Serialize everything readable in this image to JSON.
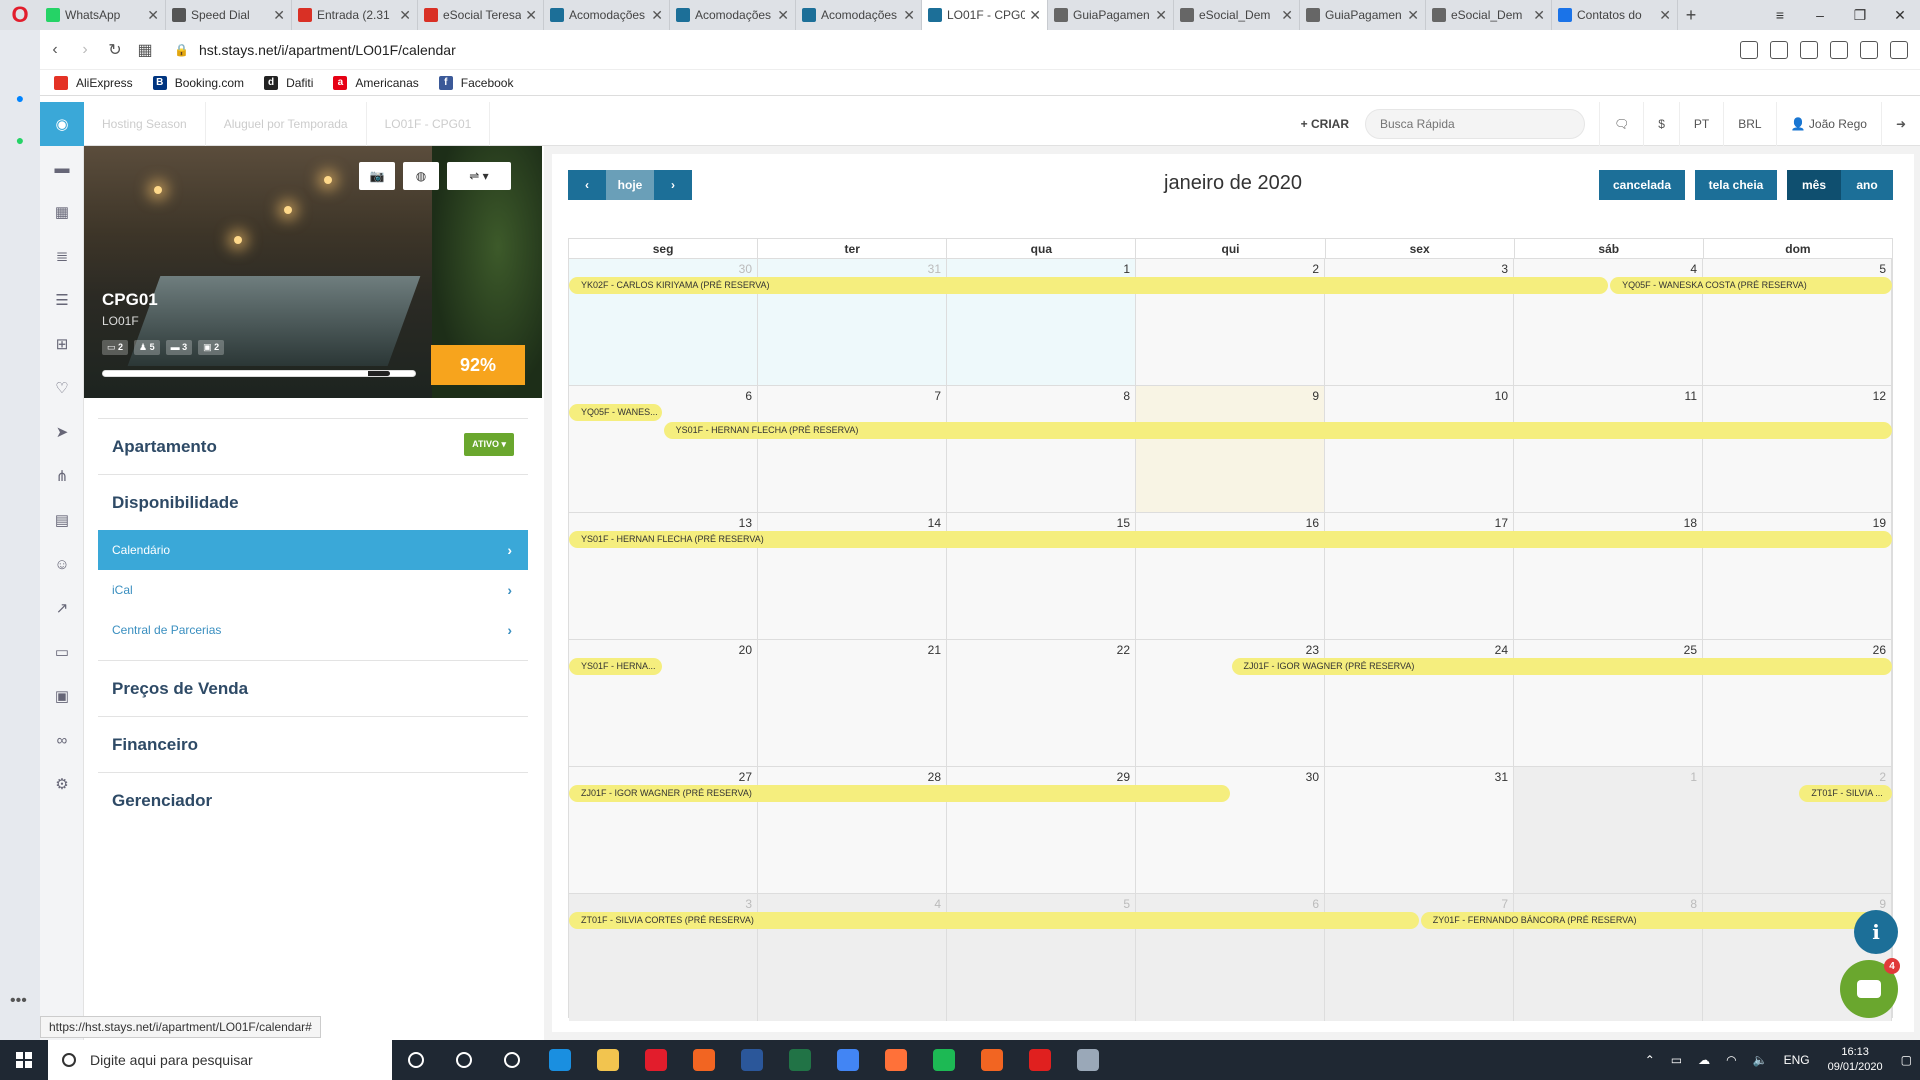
{
  "browser": {
    "tabs": [
      {
        "label": "WhatsApp",
        "icon": "whatsapp-icon",
        "color": "#25d366",
        "active": false
      },
      {
        "label": "Speed Dial",
        "icon": "speed-dial-icon",
        "color": "#555555",
        "active": false
      },
      {
        "label": "Entrada (2.31",
        "icon": "gmail-icon",
        "color": "#d93025",
        "active": false
      },
      {
        "label": "eSocial Teresa",
        "icon": "gmail-icon",
        "color": "#d93025",
        "active": false
      },
      {
        "label": "Acomodações",
        "icon": "stays-icon",
        "color": "#1c6f98",
        "active": false
      },
      {
        "label": "Acomodações",
        "icon": "stays-icon",
        "color": "#1c6f98",
        "active": false
      },
      {
        "label": "Acomodações",
        "icon": "stays-icon",
        "color": "#1c6f98",
        "active": false
      },
      {
        "label": "LO01F - CPG0",
        "icon": "stays-icon",
        "color": "#1c6f98",
        "active": true
      },
      {
        "label": "GuiaPagamen",
        "icon": "document-icon",
        "color": "#666666",
        "active": false
      },
      {
        "label": "eSocial_Dem",
        "icon": "document-icon",
        "color": "#666666",
        "active": false
      },
      {
        "label": "GuiaPagamen",
        "icon": "document-icon",
        "color": "#666666",
        "active": false
      },
      {
        "label": "eSocial_Dem",
        "icon": "document-icon",
        "color": "#666666",
        "active": false
      },
      {
        "label": "Contatos do",
        "icon": "contacts-icon",
        "color": "#1a73e8",
        "active": false
      }
    ],
    "url": "hst.stays.net/i/apartment/LO01F/calendar",
    "bookmarks": [
      {
        "label": "AliExpress",
        "color": "#e43225",
        "glyph": ""
      },
      {
        "label": "Booking.com",
        "color": "#003580",
        "glyph": "B"
      },
      {
        "label": "Dafiti",
        "color": "#222222",
        "glyph": "d"
      },
      {
        "label": "Americanas",
        "color": "#e60014",
        "glyph": "a"
      },
      {
        "label": "Facebook",
        "color": "#3b5998",
        "glyph": "f"
      }
    ],
    "status_url": "https://hst.stays.net/i/apartment/LO01F/calendar#"
  },
  "app": {
    "breadcrumbs": [
      "Hosting Season",
      "Aluguel por Temporada",
      "LO01F - CPG01"
    ],
    "criar": "+ CRIAR",
    "search_placeholder": "Busca Rápida",
    "currency_symbol": "$",
    "language": "PT",
    "currency": "BRL",
    "user": "João Rego",
    "accent": "#3aa8d8",
    "primary": "#1c6f98"
  },
  "property": {
    "name": "CPG01",
    "code": "LO01F",
    "stats": [
      "2",
      "5",
      "3",
      "2"
    ],
    "occupancy": "92%",
    "occupancy_fill": 0.92
  },
  "menu": {
    "apartamento": "Apartamento",
    "status": "ATIVO",
    "disponibilidade": "Disponibilidade",
    "items": [
      {
        "label": "Calendário",
        "active": true
      },
      {
        "label": "iCal",
        "active": false
      },
      {
        "label": "Central de Parcerias",
        "active": false
      }
    ],
    "precos": "Preços de Venda",
    "financeiro": "Financeiro",
    "gerenciador": "Gerenciador"
  },
  "calendar": {
    "title": "janeiro de 2020",
    "prev": "‹",
    "today": "hoje",
    "next": "›",
    "views": [
      "cancelada",
      "tela cheia",
      "mês",
      "ano"
    ],
    "weekdays": [
      "seg",
      "ter",
      "qua",
      "qui",
      "sex",
      "sáb",
      "dom"
    ],
    "weeks": [
      [
        {
          "n": "30",
          "o": true
        },
        {
          "n": "31",
          "o": true
        },
        {
          "n": "1"
        },
        {
          "n": "2"
        },
        {
          "n": "3"
        },
        {
          "n": "4"
        },
        {
          "n": "5"
        }
      ],
      [
        {
          "n": "6"
        },
        {
          "n": "7"
        },
        {
          "n": "8"
        },
        {
          "n": "9"
        },
        {
          "n": "10"
        },
        {
          "n": "11"
        },
        {
          "n": "12"
        }
      ],
      [
        {
          "n": "13"
        },
        {
          "n": "14"
        },
        {
          "n": "15"
        },
        {
          "n": "16"
        },
        {
          "n": "17"
        },
        {
          "n": "18"
        },
        {
          "n": "19"
        }
      ],
      [
        {
          "n": "20"
        },
        {
          "n": "21"
        },
        {
          "n": "22"
        },
        {
          "n": "23"
        },
        {
          "n": "24"
        },
        {
          "n": "25"
        },
        {
          "n": "26"
        }
      ],
      [
        {
          "n": "27"
        },
        {
          "n": "28"
        },
        {
          "n": "29"
        },
        {
          "n": "30"
        },
        {
          "n": "31"
        },
        {
          "n": "1",
          "o": true
        },
        {
          "n": "2",
          "o": true
        }
      ],
      [
        {
          "n": "3",
          "o": true
        },
        {
          "n": "4",
          "o": true
        },
        {
          "n": "5",
          "o": true
        },
        {
          "n": "6",
          "o": true
        },
        {
          "n": "7",
          "o": true
        },
        {
          "n": "8",
          "o": true
        },
        {
          "n": "9",
          "o": true
        }
      ]
    ],
    "events": [
      {
        "label": "YK02F - CARLOS KIRIYAMA (PRÉ RESERVA)",
        "week": 0,
        "start": 0,
        "end": 5.5
      },
      {
        "label": "YQ05F - WANESKA COSTA (PRÉ RESERVA)",
        "week": 0,
        "start": 5.5,
        "end": 7
      },
      {
        "label": "YQ05F - WANES...",
        "week": 1,
        "start": 0,
        "end": 0.5
      },
      {
        "label": "YS01F - HERNAN FLECHA (PRÉ RESERVA)",
        "week": 1,
        "start": 0.5,
        "end": 7,
        "row": 1
      },
      {
        "label": "YS01F - HERNAN FLECHA (PRÉ RESERVA)",
        "week": 2,
        "start": 0,
        "end": 7
      },
      {
        "label": "YS01F - HERNA...",
        "week": 3,
        "start": 0,
        "end": 0.5
      },
      {
        "label": "ZJ01F - IGOR WAGNER (PRÉ RESERVA)",
        "week": 3,
        "start": 3.5,
        "end": 7
      },
      {
        "label": "ZJ01F - IGOR WAGNER (PRÉ RESERVA)",
        "week": 4,
        "start": 0,
        "end": 3.5
      },
      {
        "label": "ZT01F - SILVIA ...",
        "week": 4,
        "start": 6.5,
        "end": 7
      },
      {
        "label": "ZT01F - SILVIA CORTES (PRÉ RESERVA)",
        "week": 5,
        "start": 0,
        "end": 4.5
      },
      {
        "label": "ZY01F - FERNANDO BÁNCORA (PRÉ RESERVA)",
        "week": 5,
        "start": 4.5,
        "end": 7
      }
    ],
    "event_color": "#f5ee7e"
  },
  "chat_badge": "4",
  "taskbar": {
    "search_placeholder": "Digite aqui para pesquisar",
    "lang": "ENG",
    "time": "16:13",
    "date": "09/01/2020",
    "apps": [
      {
        "name": "cortana-icon",
        "color": "#ffffff"
      },
      {
        "name": "task-view-icon",
        "color": "#ffffff"
      },
      {
        "name": "mail-icon",
        "color": "#ffffff"
      },
      {
        "name": "edge-icon",
        "color": "#1a8fe0"
      },
      {
        "name": "explorer-icon",
        "color": "#f2c44f"
      },
      {
        "name": "opera-icon",
        "color": "#e21d2c"
      },
      {
        "name": "app-orange-icon",
        "color": "#f26522"
      },
      {
        "name": "word-icon",
        "color": "#2b579a"
      },
      {
        "name": "excel-icon",
        "color": "#217346"
      },
      {
        "name": "chrome-icon",
        "color": "#4285f4"
      },
      {
        "name": "firefox-icon",
        "color": "#ff7139"
      },
      {
        "name": "spotify-icon",
        "color": "#1db954"
      },
      {
        "name": "app-orange2-icon",
        "color": "#f26522"
      },
      {
        "name": "acrobat-icon",
        "color": "#e0201f"
      },
      {
        "name": "tool-icon",
        "color": "#9aa8b8"
      }
    ]
  }
}
